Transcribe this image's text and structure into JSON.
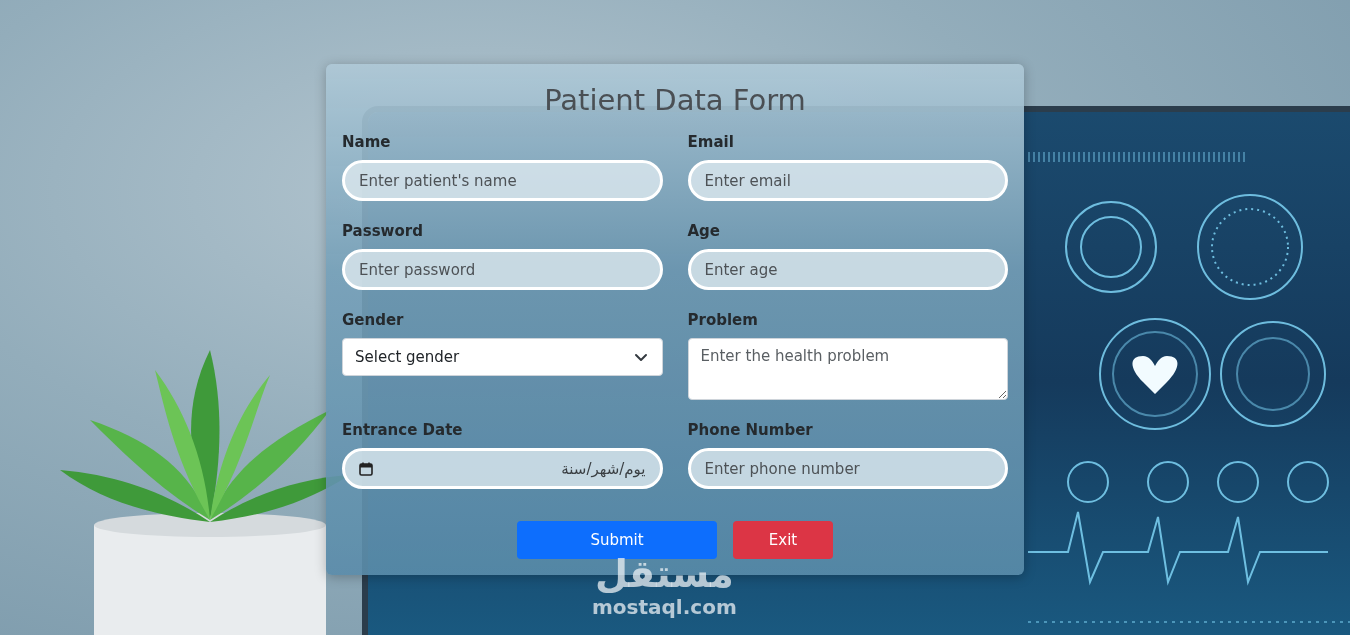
{
  "form": {
    "title": "Patient Data Form",
    "fields": [
      {
        "label": "Name",
        "placeholder": "Enter patient's name",
        "kind": "text"
      },
      {
        "label": "Email",
        "placeholder": "Enter email",
        "kind": "text"
      },
      {
        "label": "Password",
        "placeholder": "Enter password",
        "kind": "password"
      },
      {
        "label": "Age",
        "placeholder": "Enter age",
        "kind": "text"
      },
      {
        "label": "Gender",
        "placeholder": "Select gender",
        "kind": "select"
      },
      {
        "label": "Problem",
        "placeholder": "Enter the health problem",
        "kind": "textarea"
      },
      {
        "label": "Entrance Date",
        "placeholder": "يوم/شهر/سنة",
        "kind": "date"
      },
      {
        "label": "Phone Number",
        "placeholder": "Enter phone number",
        "kind": "text"
      }
    ],
    "buttons": [
      {
        "label": "Submit",
        "color": "#0d6efd"
      },
      {
        "label": "Exit",
        "color": "#dc3545"
      }
    ]
  },
  "watermark": {
    "arabic": "مستقل",
    "latin": "mostaql.com"
  }
}
